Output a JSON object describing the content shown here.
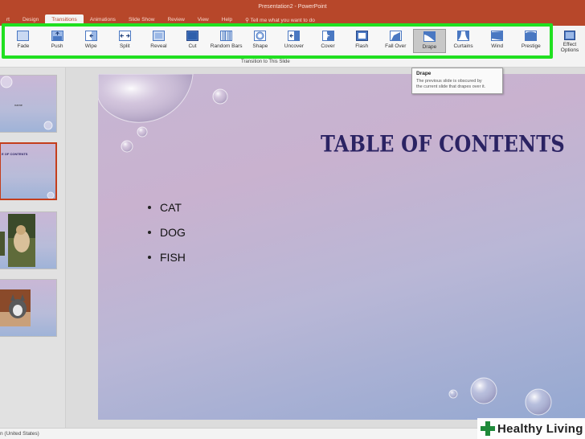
{
  "window": {
    "title": "Presentation2  -  PowerPoint",
    "tabs": [
      {
        "label": "rt"
      },
      {
        "label": "Design"
      },
      {
        "label": "Transitions",
        "active": true
      },
      {
        "label": "Animations"
      },
      {
        "label": "Slide Show"
      },
      {
        "label": "Review"
      },
      {
        "label": "View"
      },
      {
        "label": "Help"
      }
    ],
    "tell_me": "Tell me what you want to do"
  },
  "ribbon": {
    "effects": [
      {
        "label": "Fade",
        "icon": "fade-icon"
      },
      {
        "label": "Push",
        "icon": "push-icon"
      },
      {
        "label": "Wipe",
        "icon": "wipe-icon"
      },
      {
        "label": "Split",
        "icon": "split-icon"
      },
      {
        "label": "Reveal",
        "icon": "reveal-icon"
      },
      {
        "label": "Cut",
        "icon": "cut-icon"
      },
      {
        "label": "Random Bars",
        "icon": "random-bars-icon"
      },
      {
        "label": "Shape",
        "icon": "shape-icon"
      },
      {
        "label": "Uncover",
        "icon": "uncover-icon"
      },
      {
        "label": "Cover",
        "icon": "cover-icon"
      },
      {
        "label": "Flash",
        "icon": "flash-icon"
      },
      {
        "label": "Fall Over",
        "icon": "fall-over-icon"
      },
      {
        "label": "Drape",
        "icon": "drape-icon",
        "selected": true
      },
      {
        "label": "Curtains",
        "icon": "curtains-icon"
      },
      {
        "label": "Wind",
        "icon": "wind-icon"
      },
      {
        "label": "Prestige",
        "icon": "prestige-icon"
      }
    ],
    "group_label": "Transition to This Slide",
    "effect_options_line1": "Effect",
    "effect_options_line2": "Options",
    "highlight_color": "#20e020"
  },
  "tooltip": {
    "title": "Drape",
    "body_line1": "The previous slide is obscured by",
    "body_line2": "the current slide that drapes over it."
  },
  "thumbnails": [
    {
      "title": "name",
      "selected": false
    },
    {
      "title": "E OF CONTENTS",
      "selected": true
    },
    {
      "title": "",
      "selected": false,
      "photo": "dog"
    },
    {
      "title": "",
      "selected": false,
      "photo": "cat"
    }
  ],
  "slide": {
    "title": "TABLE OF CONTENTS",
    "bullets": [
      "CAT",
      "DOG",
      "FISH"
    ],
    "title_color": "#2b2363"
  },
  "status": {
    "language": "n (United States)"
  },
  "watermark": {
    "text": "Healthy Living"
  }
}
